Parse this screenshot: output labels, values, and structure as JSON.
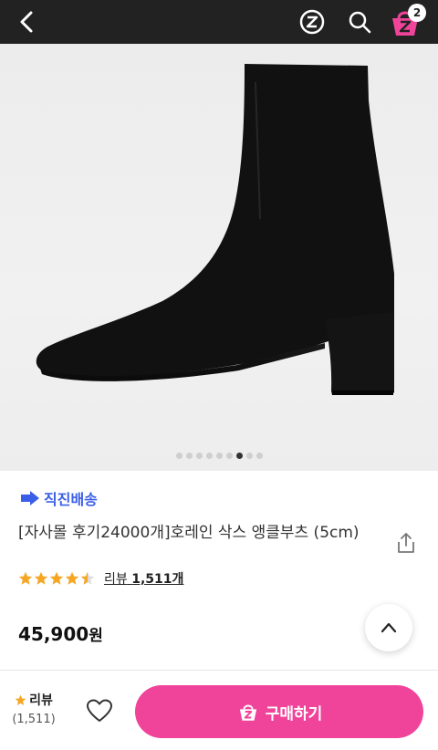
{
  "header": {
    "back_icon": "chevron-left-icon",
    "z_icon": "zigzag-z-icon",
    "search_icon": "search-icon",
    "cart_icon": "shopping-bag-icon",
    "cart_count": "2"
  },
  "gallery": {
    "total_images": 9,
    "active_index": 6
  },
  "product": {
    "delivery_badge": "직진배송",
    "title": "[자사몰 후기24000개]호레인 삭스 앵클부츠 (5cm)",
    "rating": 4.5,
    "review_label": "리뷰",
    "review_count": "1,511개",
    "price": "45,900",
    "currency": "원"
  },
  "bottom_bar": {
    "review_label": "리뷰",
    "review_count": "(1,511)",
    "buy_label": "구매하기"
  },
  "colors": {
    "header_bg": "#222222",
    "accent_pink": "#f0449b",
    "delivery_blue": "#3b5ee8",
    "star": "#f5a623"
  }
}
